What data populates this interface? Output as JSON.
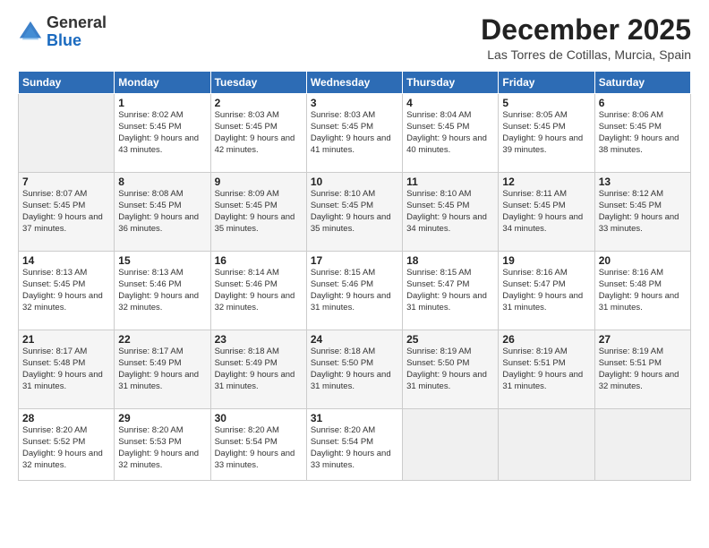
{
  "logo": {
    "general": "General",
    "blue": "Blue"
  },
  "title": {
    "month_year": "December 2025",
    "location": "Las Torres de Cotillas, Murcia, Spain"
  },
  "days_of_week": [
    "Sunday",
    "Monday",
    "Tuesday",
    "Wednesday",
    "Thursday",
    "Friday",
    "Saturday"
  ],
  "weeks": [
    [
      {
        "day": "",
        "sunrise": "",
        "sunset": "",
        "daylight": ""
      },
      {
        "day": "1",
        "sunrise": "Sunrise: 8:02 AM",
        "sunset": "Sunset: 5:45 PM",
        "daylight": "Daylight: 9 hours and 43 minutes."
      },
      {
        "day": "2",
        "sunrise": "Sunrise: 8:03 AM",
        "sunset": "Sunset: 5:45 PM",
        "daylight": "Daylight: 9 hours and 42 minutes."
      },
      {
        "day": "3",
        "sunrise": "Sunrise: 8:03 AM",
        "sunset": "Sunset: 5:45 PM",
        "daylight": "Daylight: 9 hours and 41 minutes."
      },
      {
        "day": "4",
        "sunrise": "Sunrise: 8:04 AM",
        "sunset": "Sunset: 5:45 PM",
        "daylight": "Daylight: 9 hours and 40 minutes."
      },
      {
        "day": "5",
        "sunrise": "Sunrise: 8:05 AM",
        "sunset": "Sunset: 5:45 PM",
        "daylight": "Daylight: 9 hours and 39 minutes."
      },
      {
        "day": "6",
        "sunrise": "Sunrise: 8:06 AM",
        "sunset": "Sunset: 5:45 PM",
        "daylight": "Daylight: 9 hours and 38 minutes."
      }
    ],
    [
      {
        "day": "7",
        "sunrise": "Sunrise: 8:07 AM",
        "sunset": "Sunset: 5:45 PM",
        "daylight": "Daylight: 9 hours and 37 minutes."
      },
      {
        "day": "8",
        "sunrise": "Sunrise: 8:08 AM",
        "sunset": "Sunset: 5:45 PM",
        "daylight": "Daylight: 9 hours and 36 minutes."
      },
      {
        "day": "9",
        "sunrise": "Sunrise: 8:09 AM",
        "sunset": "Sunset: 5:45 PM",
        "daylight": "Daylight: 9 hours and 35 minutes."
      },
      {
        "day": "10",
        "sunrise": "Sunrise: 8:10 AM",
        "sunset": "Sunset: 5:45 PM",
        "daylight": "Daylight: 9 hours and 35 minutes."
      },
      {
        "day": "11",
        "sunrise": "Sunrise: 8:10 AM",
        "sunset": "Sunset: 5:45 PM",
        "daylight": "Daylight: 9 hours and 34 minutes."
      },
      {
        "day": "12",
        "sunrise": "Sunrise: 8:11 AM",
        "sunset": "Sunset: 5:45 PM",
        "daylight": "Daylight: 9 hours and 34 minutes."
      },
      {
        "day": "13",
        "sunrise": "Sunrise: 8:12 AM",
        "sunset": "Sunset: 5:45 PM",
        "daylight": "Daylight: 9 hours and 33 minutes."
      }
    ],
    [
      {
        "day": "14",
        "sunrise": "Sunrise: 8:13 AM",
        "sunset": "Sunset: 5:45 PM",
        "daylight": "Daylight: 9 hours and 32 minutes."
      },
      {
        "day": "15",
        "sunrise": "Sunrise: 8:13 AM",
        "sunset": "Sunset: 5:46 PM",
        "daylight": "Daylight: 9 hours and 32 minutes."
      },
      {
        "day": "16",
        "sunrise": "Sunrise: 8:14 AM",
        "sunset": "Sunset: 5:46 PM",
        "daylight": "Daylight: 9 hours and 32 minutes."
      },
      {
        "day": "17",
        "sunrise": "Sunrise: 8:15 AM",
        "sunset": "Sunset: 5:46 PM",
        "daylight": "Daylight: 9 hours and 31 minutes."
      },
      {
        "day": "18",
        "sunrise": "Sunrise: 8:15 AM",
        "sunset": "Sunset: 5:47 PM",
        "daylight": "Daylight: 9 hours and 31 minutes."
      },
      {
        "day": "19",
        "sunrise": "Sunrise: 8:16 AM",
        "sunset": "Sunset: 5:47 PM",
        "daylight": "Daylight: 9 hours and 31 minutes."
      },
      {
        "day": "20",
        "sunrise": "Sunrise: 8:16 AM",
        "sunset": "Sunset: 5:48 PM",
        "daylight": "Daylight: 9 hours and 31 minutes."
      }
    ],
    [
      {
        "day": "21",
        "sunrise": "Sunrise: 8:17 AM",
        "sunset": "Sunset: 5:48 PM",
        "daylight": "Daylight: 9 hours and 31 minutes."
      },
      {
        "day": "22",
        "sunrise": "Sunrise: 8:17 AM",
        "sunset": "Sunset: 5:49 PM",
        "daylight": "Daylight: 9 hours and 31 minutes."
      },
      {
        "day": "23",
        "sunrise": "Sunrise: 8:18 AM",
        "sunset": "Sunset: 5:49 PM",
        "daylight": "Daylight: 9 hours and 31 minutes."
      },
      {
        "day": "24",
        "sunrise": "Sunrise: 8:18 AM",
        "sunset": "Sunset: 5:50 PM",
        "daylight": "Daylight: 9 hours and 31 minutes."
      },
      {
        "day": "25",
        "sunrise": "Sunrise: 8:19 AM",
        "sunset": "Sunset: 5:50 PM",
        "daylight": "Daylight: 9 hours and 31 minutes."
      },
      {
        "day": "26",
        "sunrise": "Sunrise: 8:19 AM",
        "sunset": "Sunset: 5:51 PM",
        "daylight": "Daylight: 9 hours and 31 minutes."
      },
      {
        "day": "27",
        "sunrise": "Sunrise: 8:19 AM",
        "sunset": "Sunset: 5:51 PM",
        "daylight": "Daylight: 9 hours and 32 minutes."
      }
    ],
    [
      {
        "day": "28",
        "sunrise": "Sunrise: 8:20 AM",
        "sunset": "Sunset: 5:52 PM",
        "daylight": "Daylight: 9 hours and 32 minutes."
      },
      {
        "day": "29",
        "sunrise": "Sunrise: 8:20 AM",
        "sunset": "Sunset: 5:53 PM",
        "daylight": "Daylight: 9 hours and 32 minutes."
      },
      {
        "day": "30",
        "sunrise": "Sunrise: 8:20 AM",
        "sunset": "Sunset: 5:54 PM",
        "daylight": "Daylight: 9 hours and 33 minutes."
      },
      {
        "day": "31",
        "sunrise": "Sunrise: 8:20 AM",
        "sunset": "Sunset: 5:54 PM",
        "daylight": "Daylight: 9 hours and 33 minutes."
      },
      {
        "day": "",
        "sunrise": "",
        "sunset": "",
        "daylight": ""
      },
      {
        "day": "",
        "sunrise": "",
        "sunset": "",
        "daylight": ""
      },
      {
        "day": "",
        "sunrise": "",
        "sunset": "",
        "daylight": ""
      }
    ]
  ]
}
